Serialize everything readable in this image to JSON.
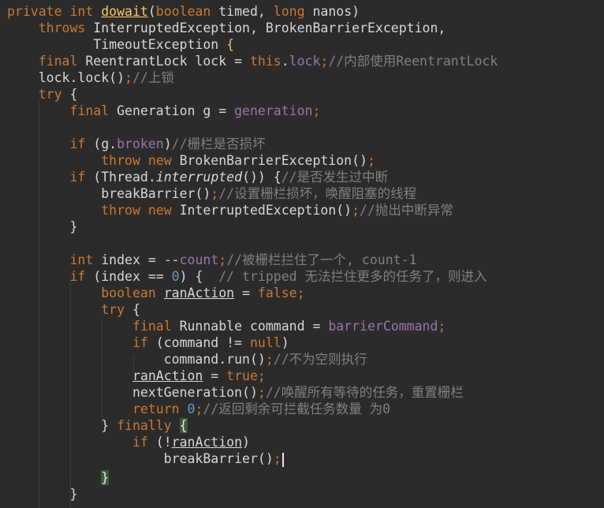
{
  "code_editor": {
    "lines": [
      "private int dowait(boolean timed, long nanos)",
      "    throws InterruptedException, BrokenBarrierException,",
      "           TimeoutException {",
      "    final ReentrantLock lock = this.lock;//内部使用ReentrantLock",
      "    lock.lock();//上锁",
      "    try {",
      "        final Generation g = generation;",
      "",
      "        if (g.broken)//栅栏是否损坏",
      "            throw new BrokenBarrierException();",
      "        if (Thread.interrupted()) {//是否发生过中断",
      "            breakBarrier();//设置栅栏损坏，唤醒阻塞的线程",
      "            throw new InterruptedException();//抛出中断异常",
      "        }",
      "",
      "        int index = --count;//被栅栏拦住了一个, count-1",
      "        if (index == 0) {  // tripped 无法拦住更多的任务了，则进入",
      "            boolean ranAction = false;",
      "            try {",
      "                final Runnable command = barrierCommand;",
      "                if (command != null)",
      "                    command.run();//不为空则执行",
      "                ranAction = true;",
      "                nextGeneration();//唤醒所有等待的任务，重置栅栏",
      "                return 0;//返回剩余可拦截任务数量 为0",
      "            } finally {",
      "                if (!ranAction)",
      "                    breakBarrier();",
      "",
      "            }",
      "        }"
    ]
  }
}
